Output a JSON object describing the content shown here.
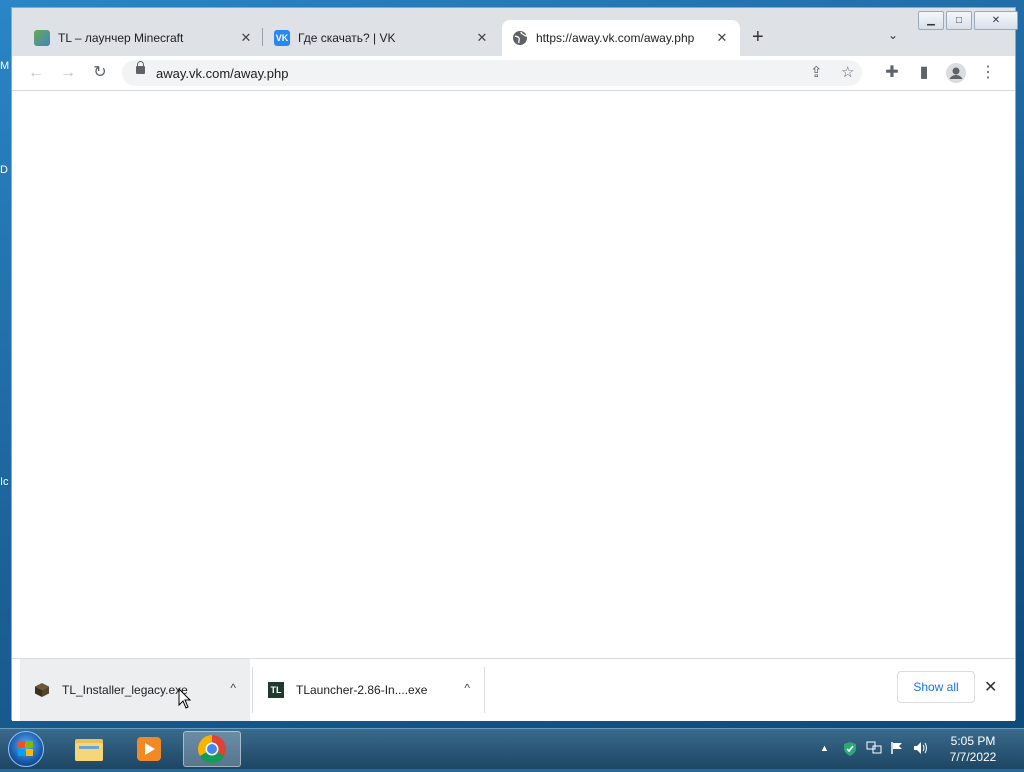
{
  "desktop": {
    "edge_letters": [
      "M",
      "D",
      "Ic"
    ]
  },
  "browser": {
    "tabs": [
      {
        "title": "TL – лаунчер Minecraft",
        "favicon": "tl-globe-icon",
        "active": false
      },
      {
        "title": "Где скачать? | VK",
        "favicon": "vk-icon",
        "active": false
      },
      {
        "title": "https://away.vk.com/away.php",
        "favicon": "globe-icon",
        "active": true
      }
    ],
    "new_tab": "+",
    "tab_list": "⌄",
    "window_controls": {
      "minimize": "▁",
      "maximize": "□",
      "close": "✕"
    },
    "toolbar": {
      "back": "←",
      "forward": "→",
      "reload": "↻",
      "url": "away.vk.com/away.php",
      "share": "⇪",
      "bookmark": "☆",
      "extensions": "✚",
      "sidepanel": "▮",
      "menu": "⋮"
    }
  },
  "downloads": {
    "items": [
      {
        "name": "TL_Installer_legacy.exe",
        "icon": "minecraft-block-icon"
      },
      {
        "name": "TLauncher-2.86-In....exe",
        "icon": "tl-logo-icon",
        "badge": "TL"
      }
    ],
    "chevron": "^",
    "show_all": "Show all",
    "close": "✕"
  },
  "taskbar": {
    "apps": [
      "explorer",
      "media-player",
      "chrome"
    ],
    "tray_arrow": "▲",
    "time": "5:05 PM",
    "date": "7/7/2022"
  },
  "colors": {
    "accent": "#1a73e8",
    "vk": "#2787f5",
    "tl_logo": "#1f3a2e"
  }
}
